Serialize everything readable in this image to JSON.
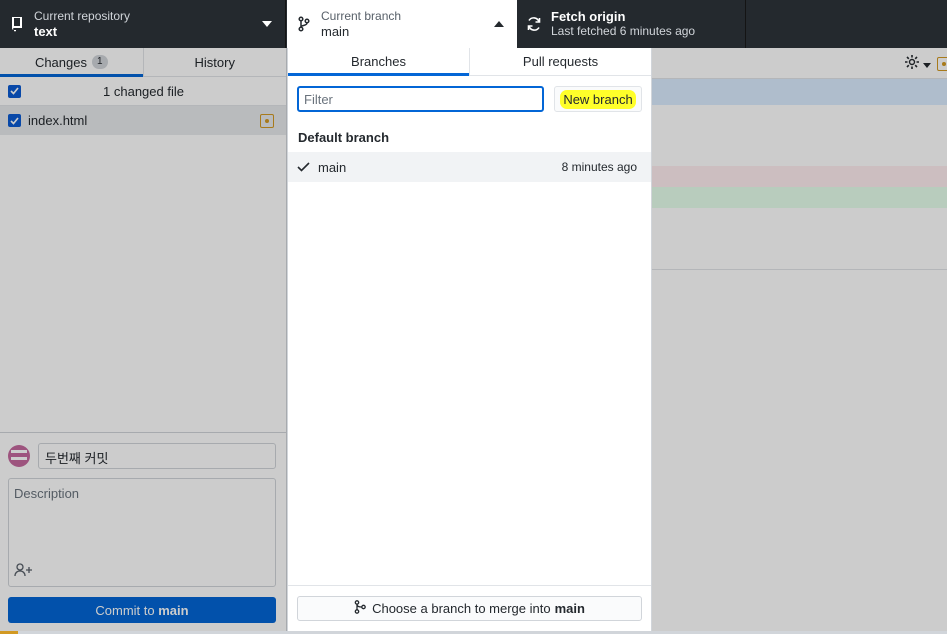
{
  "toolbar": {
    "repo": {
      "label": "Current repository",
      "value": "text",
      "icon": "repo-icon"
    },
    "branch": {
      "label": "Current branch",
      "value": "main",
      "icon": "git-branch-icon"
    },
    "fetch": {
      "label": "Fetch origin",
      "status": "Last fetched 6 minutes ago",
      "icon": "sync-icon"
    }
  },
  "sidebar": {
    "tabs": [
      {
        "label": "Changes",
        "count": "1"
      },
      {
        "label": "History"
      }
    ],
    "changes_summary": "1 changed file",
    "files": [
      {
        "name": "index.html",
        "status": "modified"
      }
    ],
    "commit": {
      "summary_value": "두번째 커밋",
      "description_placeholder": "Description",
      "button_prefix": "Commit to",
      "button_branch": "main"
    }
  },
  "branch_dropdown": {
    "tabs": [
      "Branches",
      "Pull requests"
    ],
    "filter_placeholder": "Filter",
    "new_branch_label": "New branch",
    "section_title": "Default branch",
    "branches": [
      {
        "name": "main",
        "time": "8 minutes ago",
        "current": true
      }
    ],
    "merge_prefix": "Choose a branch to merge into",
    "merge_branch": "main"
  },
  "colors": {
    "accent": "#0366d6",
    "toolbar_bg": "#24292e",
    "modified": "#d29922",
    "highlight": "#ffff2a"
  }
}
